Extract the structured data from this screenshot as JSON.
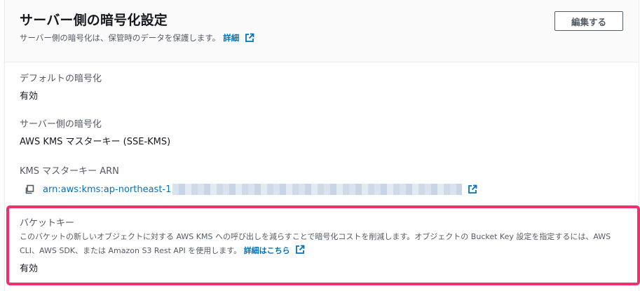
{
  "header": {
    "title": "サーバー側の暗号化設定",
    "subtitle": "サーバー側の暗号化は、保管時のデータを保護します。",
    "details_link": "詳細",
    "edit_button": "編集する"
  },
  "fields": {
    "default_encryption": {
      "label": "デフォルトの暗号化",
      "value": "有効"
    },
    "server_side_encryption": {
      "label": "サーバー側の暗号化",
      "value": "AWS KMS マスターキー (SSE-KMS)"
    },
    "kms_master_key_arn": {
      "label": "KMS マスターキー ARN",
      "value": "arn:aws:kms:ap-northeast-1"
    }
  },
  "bucket_key": {
    "label": "バケットキー",
    "description": "このバケットの新しいオブジェクトに対する AWS KMS への呼び出しを減らすことで暗号化コストを削減します。オブジェクトの Bucket Key 設定を指定するには、AWS CLI、AWS SDK、または Amazon S3 Rest API を使用します。",
    "learn_more_link": "詳細はこちら",
    "value": "有効"
  },
  "colors": {
    "link": "#0073bb",
    "highlight": "#f0306a"
  },
  "icons": [
    "external-link-icon",
    "copy-icon"
  ]
}
